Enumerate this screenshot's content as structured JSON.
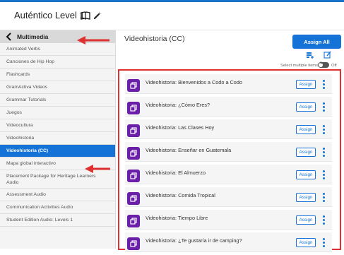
{
  "header": {
    "app_title": "Auténtico Level 1"
  },
  "sidebar": {
    "back_label": "Multimedia",
    "items": [
      {
        "label": "Animated Verbs",
        "active": false
      },
      {
        "label": "Canciones de Hip Hop",
        "active": false
      },
      {
        "label": "Flashcards",
        "active": false
      },
      {
        "label": "GramActiva Videos",
        "active": false
      },
      {
        "label": "Grammar Tutorials",
        "active": false
      },
      {
        "label": "Juegos",
        "active": false
      },
      {
        "label": "Videocultura",
        "active": false
      },
      {
        "label": "Videohistoria",
        "active": false
      },
      {
        "label": "Videohistoria (CC)",
        "active": true
      },
      {
        "label": "Mapa global interactivo",
        "active": false
      },
      {
        "label": "Placement Package for Heritage Learners Audio",
        "active": false
      },
      {
        "label": "Assessment Audio",
        "active": false
      },
      {
        "label": "Communication Activities Audio",
        "active": false
      },
      {
        "label": "Student Edition Audio: Levels 1",
        "active": false
      }
    ]
  },
  "main": {
    "title": "Videohistoria (CC)",
    "assign_all_label": "Assign All",
    "select_multiple_label": "Select multiple items",
    "toggle_state_label": "Off",
    "items": [
      {
        "label": "Videohistoria: Bienvenidos a Codo a Codo",
        "assign_label": "Assign"
      },
      {
        "label": "Videohistoria: ¿Cómo Eres?",
        "assign_label": "Assign"
      },
      {
        "label": "Videohistoria: Las Clases Hoy",
        "assign_label": "Assign"
      },
      {
        "label": "Videohistoria: Enseñar en Guatemala",
        "assign_label": "Assign"
      },
      {
        "label": "Videohistoria: El Almuerzo",
        "assign_label": "Assign"
      },
      {
        "label": "Videohistoria: Comida Tropical",
        "assign_label": "Assign"
      },
      {
        "label": "Videohistoria: Tiempo Libre",
        "assign_label": "Assign"
      },
      {
        "label": "Videohistoria: ¿Te gustaría ir de camping?",
        "assign_label": "Assign"
      }
    ]
  },
  "colors": {
    "accent": "#1572d6",
    "resource_icon": "#6a1fa8",
    "annotation_red": "#e03131"
  },
  "icons": [
    "book-icon",
    "wrench-icon",
    "chevron-left-icon",
    "add-to-folder-icon",
    "edit-icon",
    "video-resource-icon",
    "more-options-icon",
    "red-arrow-annotation"
  ]
}
